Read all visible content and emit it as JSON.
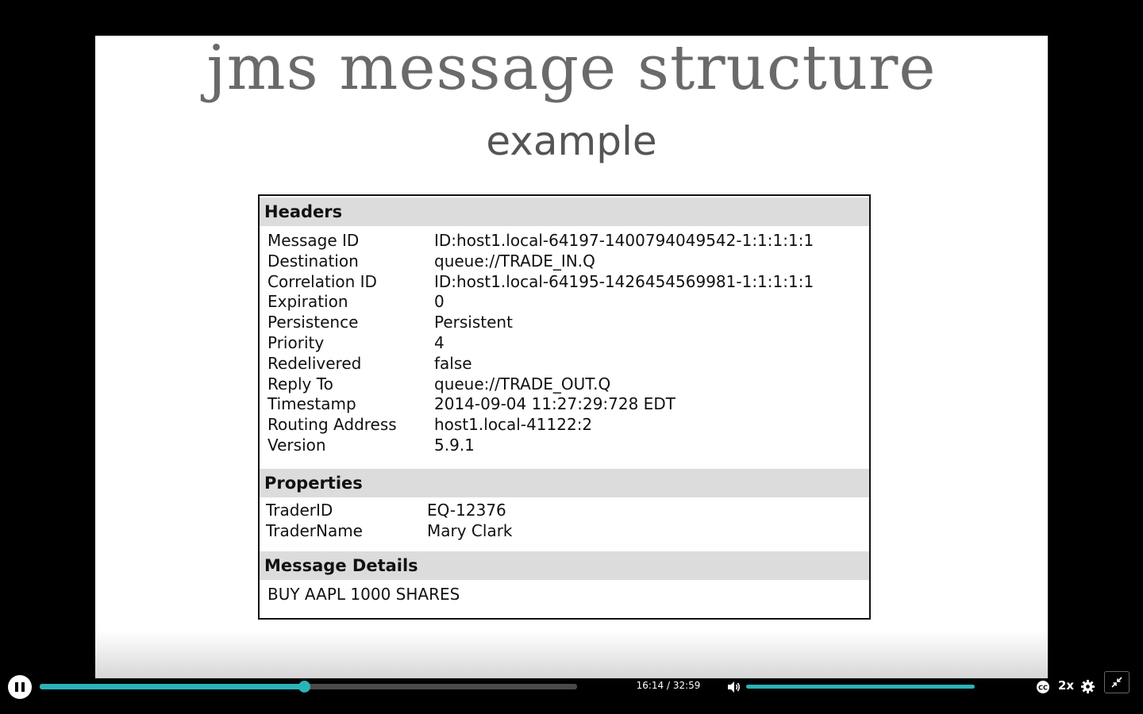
{
  "slide": {
    "title": "jms message structure",
    "subtitle": "example",
    "headers_title": "Headers",
    "headers": [
      {
        "key": "Message ID",
        "value": "ID:host1.local-64197-1400794049542-1:1:1:1:1"
      },
      {
        "key": "Destination",
        "value": "queue://TRADE_IN.Q"
      },
      {
        "key": "Correlation ID",
        "value": "ID:host1.local-64195-1426454569981-1:1:1:1:1"
      },
      {
        "key": "Expiration",
        "value": "0"
      },
      {
        "key": "Persistence",
        "value": "Persistent"
      },
      {
        "key": "Priority",
        "value": "4"
      },
      {
        "key": "Redelivered",
        "value": "false"
      },
      {
        "key": "Reply To",
        "value": "queue://TRADE_OUT.Q"
      },
      {
        "key": "Timestamp",
        "value": "2014-09-04 11:27:29:728 EDT"
      },
      {
        "key": "Routing Address",
        "value": "host1.local-41122:2"
      },
      {
        "key": "Version",
        "value": "5.9.1"
      }
    ],
    "properties_title": "Properties",
    "properties": [
      {
        "key": "TraderID",
        "value": "EQ-12376"
      },
      {
        "key": "TraderName",
        "value": "Mary Clark"
      }
    ],
    "details_title": "Message Details",
    "details_body": "BUY AAPL 1000 SHARES"
  },
  "player": {
    "time_display": "16:14 / 32:59",
    "progress_fraction": 0.492,
    "volume_fraction": 1.0,
    "speed_label": "2x",
    "accent_color": "#2ab3b8",
    "icons": [
      "pause-icon",
      "volume-icon",
      "closed-captions-icon",
      "gear-icon",
      "exit-fullscreen-icon"
    ]
  }
}
